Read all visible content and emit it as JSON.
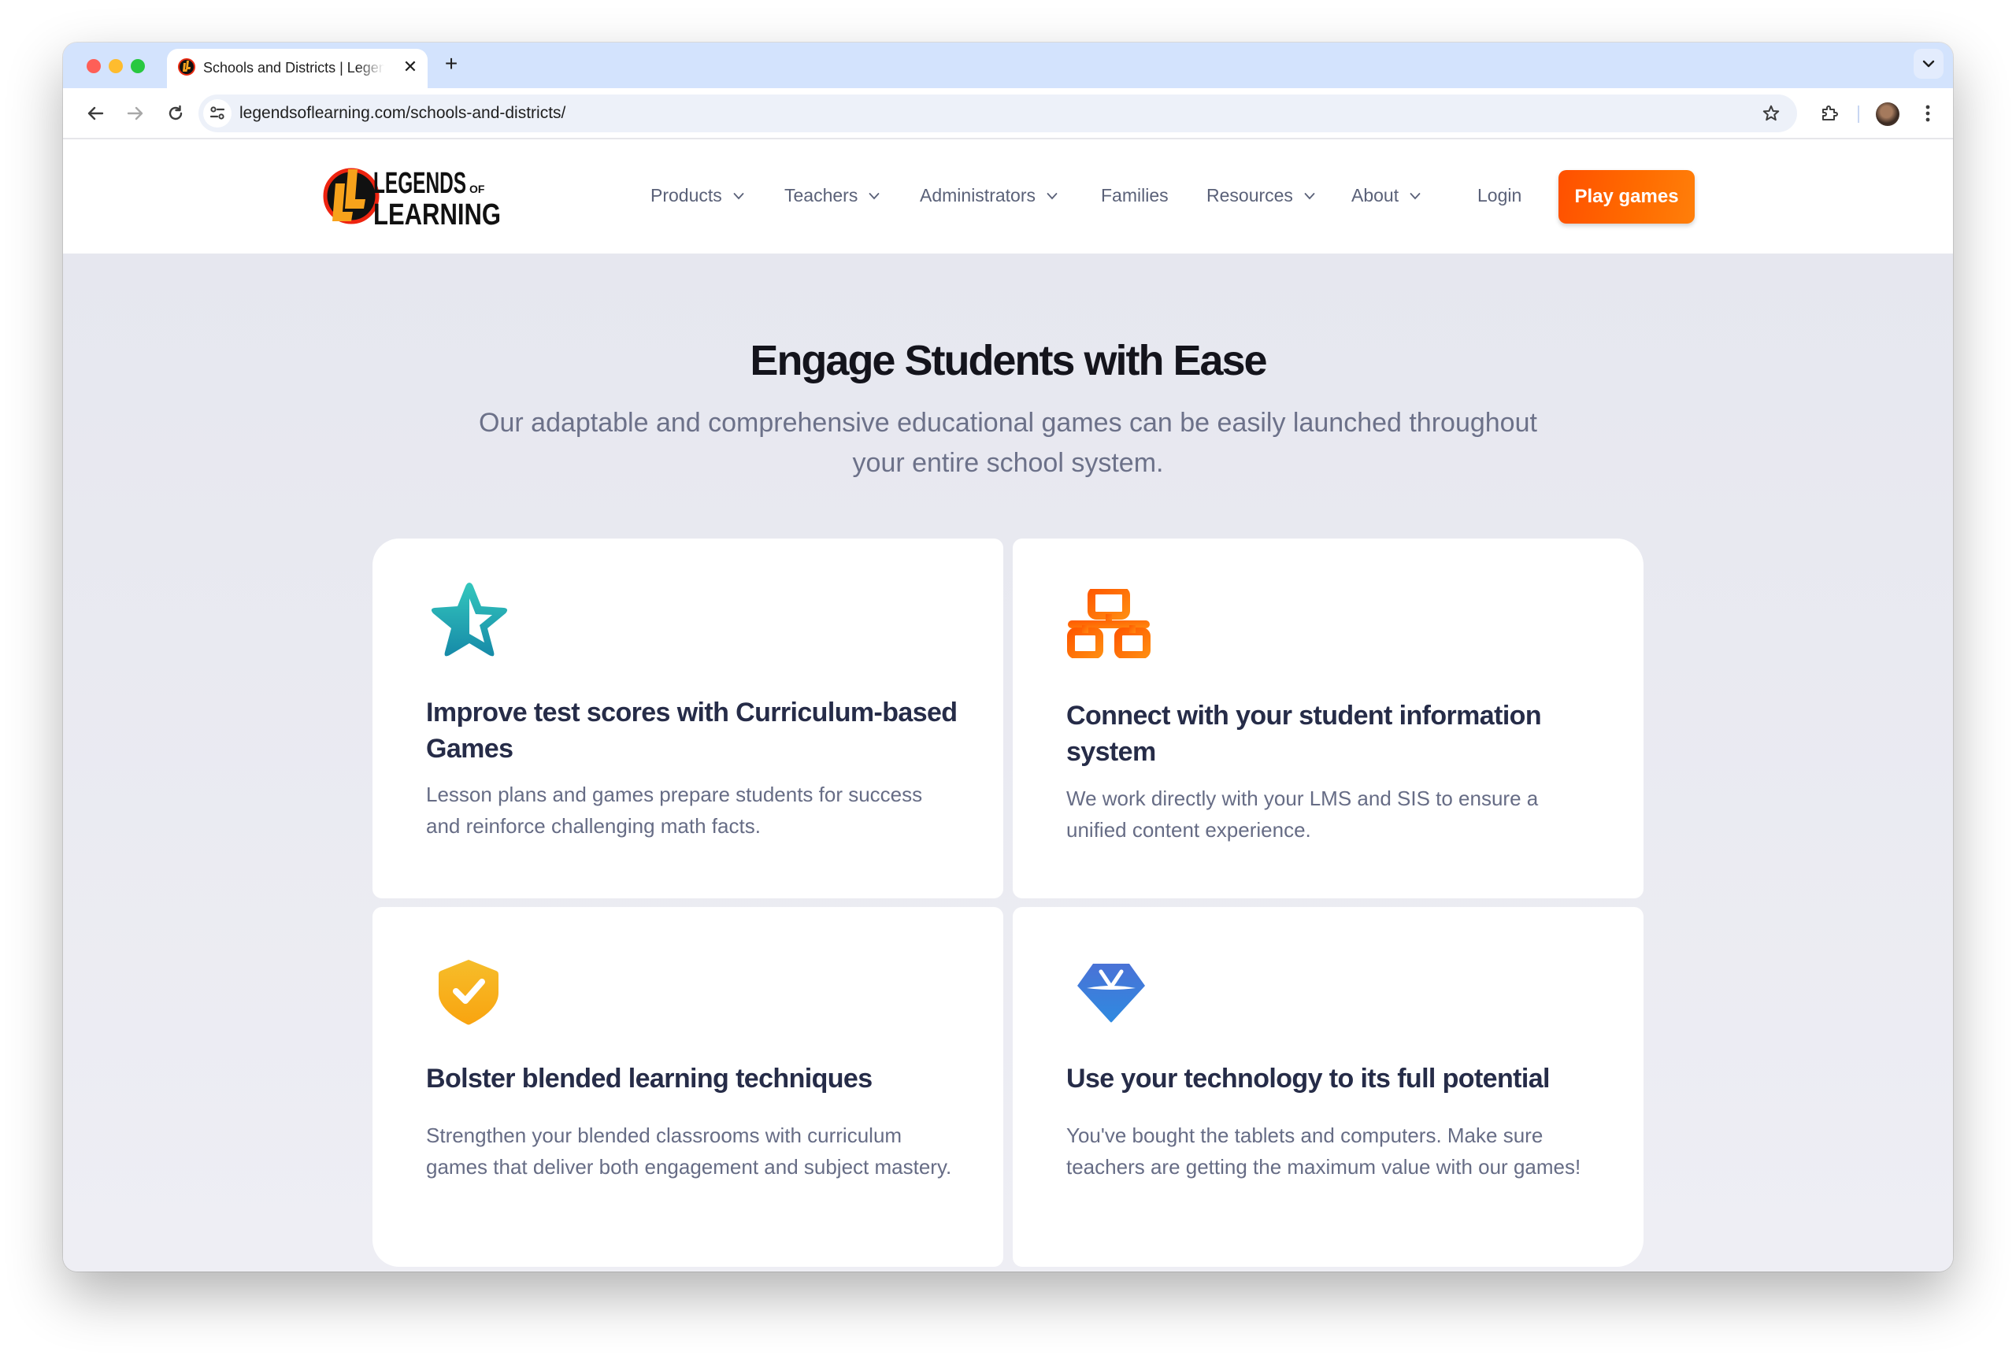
{
  "browser": {
    "tab_title": "Schools and Districts | Legends of Learning",
    "url": "legendsoflearning.com/schools-and-districts/",
    "tab_close_icon": "close-icon",
    "new_tab_icon": "plus-icon"
  },
  "header": {
    "logo_text_line1": "LEGENDS",
    "logo_text_of": "OF",
    "logo_text_line2": "LEARNING",
    "nav": [
      {
        "label": "Products",
        "has_dropdown": true
      },
      {
        "label": "Teachers",
        "has_dropdown": true
      },
      {
        "label": "Administrators",
        "has_dropdown": true
      },
      {
        "label": "Families",
        "has_dropdown": false
      },
      {
        "label": "Resources",
        "has_dropdown": true
      },
      {
        "label": "About",
        "has_dropdown": true
      }
    ],
    "login_label": "Login",
    "cta_label": "Play games",
    "cta_color": "#ff6a00"
  },
  "section": {
    "title": "Engage Students with Ease",
    "subtitle": "Our adaptable and comprehensive educational games can be easily launched throughout your entire school system."
  },
  "cards": [
    {
      "icon": "star-icon",
      "icon_color": "#1fa6b0",
      "title": "Improve test scores with Curriculum-based Games",
      "description": "Lesson plans and games prepare students for success and reinforce challenging math facts."
    },
    {
      "icon": "network-icon",
      "icon_color": "#ff6a00",
      "title": "Connect with your student information system",
      "description": "We work directly with your LMS and SIS to ensure a unified content experience."
    },
    {
      "icon": "shield-check-icon",
      "icon_color": "#f7b21f",
      "title": "Bolster blended learning techniques",
      "description": "Strengthen your blended classrooms with curriculum games that deliver both engagement and subject mastery."
    },
    {
      "icon": "diamond-icon",
      "icon_color": "#3a7bd5",
      "title": "Use your technology to its full potential",
      "description": "You've bought the tablets and computers. Make sure teachers are getting the maximum value with our games!"
    }
  ]
}
